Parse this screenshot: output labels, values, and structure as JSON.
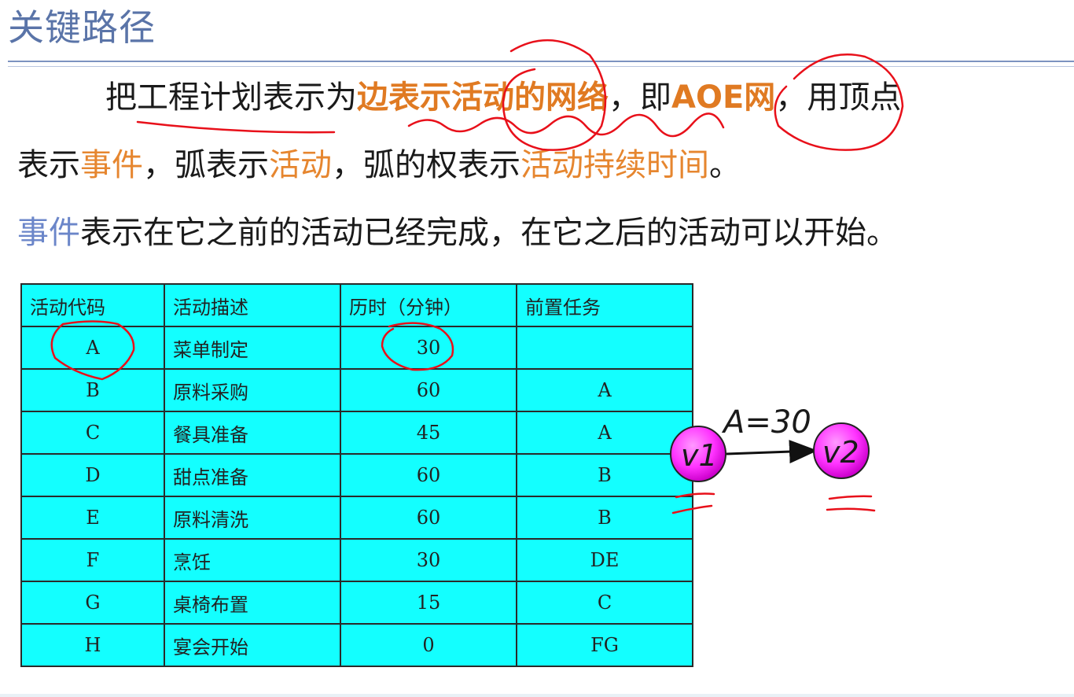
{
  "slide": {
    "title": "关键路径"
  },
  "paragraphs": {
    "p1_a": "把工程计划表示为",
    "p1_b": "边表示活动的网络",
    "p1_c": "，即",
    "p1_d": "AOE网",
    "p1_e": "，用顶点",
    "p2_a": "表示",
    "p2_b": "事件",
    "p2_c": "，弧表示",
    "p2_d": "活动",
    "p2_e": "，弧的权表示",
    "p2_f": "活动持续时间",
    "p2_g": "。",
    "p3_a": "事件",
    "p3_b": "表示在它之前的活动已经完成，在它之后的活动可以开始。"
  },
  "table": {
    "headers": [
      "活动代码",
      "活动描述",
      "历时（分钟）",
      "前置任务"
    ],
    "rows": [
      {
        "code": "A",
        "desc": "菜单制定",
        "duration": "30",
        "pre": ""
      },
      {
        "code": "B",
        "desc": "原料采购",
        "duration": "60",
        "pre": "A"
      },
      {
        "code": "C",
        "desc": "餐具准备",
        "duration": "45",
        "pre": "A"
      },
      {
        "code": "D",
        "desc": "甜点准备",
        "duration": "60",
        "pre": "B"
      },
      {
        "code": "E",
        "desc": "原料清洗",
        "duration": "60",
        "pre": "B"
      },
      {
        "code": "F",
        "desc": "烹饪",
        "duration": "30",
        "pre": "DE"
      },
      {
        "code": "G",
        "desc": "桌椅布置",
        "duration": "15",
        "pre": "C"
      },
      {
        "code": "H",
        "desc": "宴会开始",
        "duration": "0",
        "pre": "FG"
      }
    ]
  },
  "graph": {
    "node1": "v1",
    "node2": "v2",
    "edge_label": "A=30"
  },
  "colors": {
    "title": "#5a74a8",
    "highlight_orange": "#e6862f",
    "highlight_blue": "#6b86c9",
    "table_bg": "#13ffff",
    "node_fill": "#ff33ff",
    "pen_red": "#e8101a"
  }
}
